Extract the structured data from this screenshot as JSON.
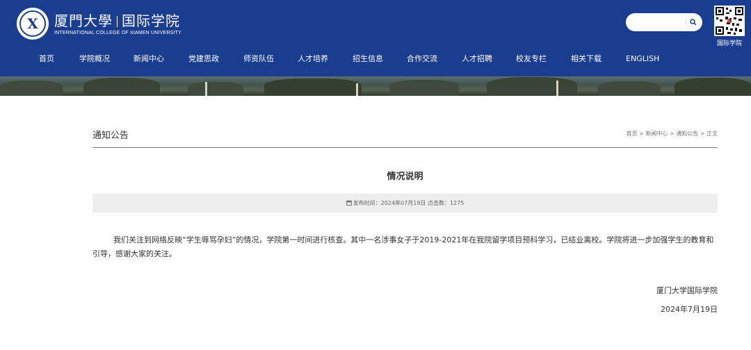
{
  "header": {
    "logo_cn": "厦門大學",
    "logo_college": "国际学院",
    "logo_en": "INTERNATIONAL COLLEGE OF XIAMEN UNIVERSITY",
    "emblem_char": "X",
    "search_placeholder": "",
    "search_icon": "search-icon",
    "qr_label": "国际学院",
    "bg_color": "#1a3d8f"
  },
  "nav": {
    "items": [
      {
        "label": "首页"
      },
      {
        "label": "学院概况"
      },
      {
        "label": "新闻中心"
      },
      {
        "label": "党建思政"
      },
      {
        "label": "师资队伍"
      },
      {
        "label": "人才培养"
      },
      {
        "label": "招生信息"
      },
      {
        "label": "合作交流"
      },
      {
        "label": "人才招聘"
      },
      {
        "label": "校友专栏"
      },
      {
        "label": "相关下载"
      },
      {
        "label": "ENGLISH"
      }
    ]
  },
  "section": {
    "title": "通知公告",
    "breadcrumb": "首页 > 新闻中心 > 通知公告 > 正文"
  },
  "article": {
    "title": "情况说明",
    "meta": "发布时间：2024年07月19日 点击数：1275",
    "meta_icon": "calendar-icon",
    "body": "我们关注到网络反映“学生辱骂孕妇”的情况，学院第一时间进行核查。其中一名涉事女子于2019-2021年在我院留学项目预科学习，已结业离校。学院将进一步加强学生的教育和引导，感谢大家的关注。",
    "signature": "厦门大学国际学院",
    "date": "2024年7月19日"
  }
}
